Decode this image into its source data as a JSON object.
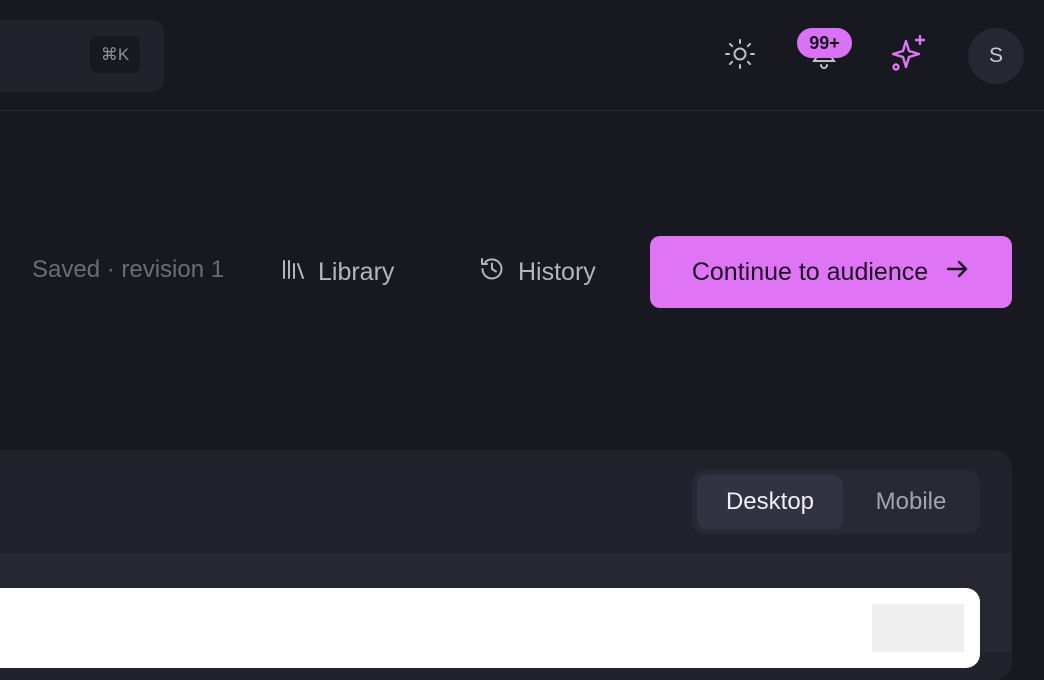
{
  "topbar": {
    "search_shortcut": "⌘K",
    "theme_icon": "sun-icon",
    "notifications": {
      "icon": "bell-icon",
      "badge": "99+"
    },
    "assistant_icon": "sparkles-icon",
    "avatar_initial": "S"
  },
  "editor": {
    "save_status": "Saved · revision 1",
    "library_label": "Library",
    "history_label": "History",
    "continue_label": "Continue to audience"
  },
  "preview": {
    "desktop_label": "Desktop",
    "mobile_label": "Mobile",
    "selected": "Desktop"
  },
  "colors": {
    "accent": "#DF74F5",
    "background": "#181821",
    "panel": "#22222C"
  }
}
